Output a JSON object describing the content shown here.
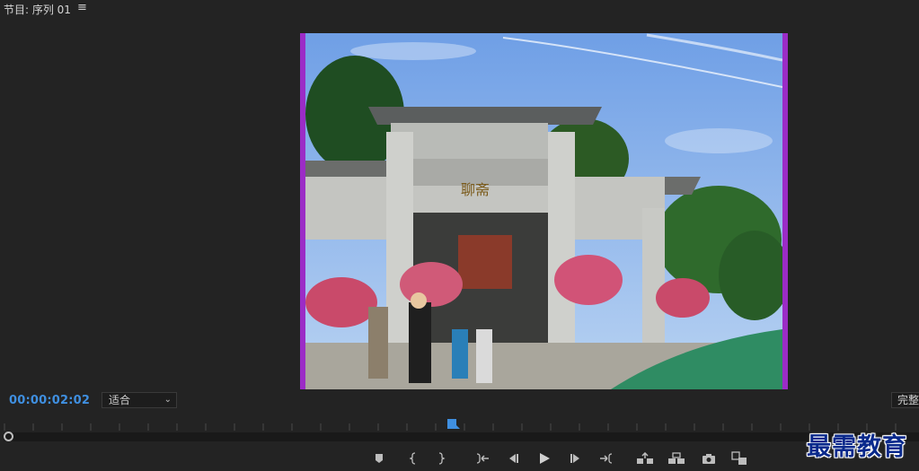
{
  "panel": {
    "title": "节目: 序列 01",
    "menu_icon": "hamburger-menu-icon"
  },
  "monitor": {
    "image_description": "stone memorial archway",
    "archway_inscription": "聊斋",
    "border_color": "#9b2cc6"
  },
  "status": {
    "timecode": "00:00:02:02",
    "zoom_value": "适合",
    "resolution_value": "完整"
  },
  "controls": [
    {
      "name": "add-marker-button",
      "icon": "marker-icon"
    },
    {
      "name": "mark-in-button",
      "icon": "mark-in-icon"
    },
    {
      "name": "mark-out-button",
      "icon": "mark-out-icon"
    },
    {
      "name": "go-to-in-button",
      "icon": "go-to-in-icon"
    },
    {
      "name": "step-back-button",
      "icon": "step-back-icon"
    },
    {
      "name": "play-button",
      "icon": "play-icon"
    },
    {
      "name": "step-forward-button",
      "icon": "step-forward-icon"
    },
    {
      "name": "go-to-out-button",
      "icon": "go-to-out-icon"
    },
    {
      "name": "lift-button",
      "icon": "lift-icon"
    },
    {
      "name": "extract-button",
      "icon": "extract-icon"
    },
    {
      "name": "export-frame-button",
      "icon": "camera-icon"
    },
    {
      "name": "comparison-view-button",
      "icon": "comparison-icon"
    }
  ],
  "watermark": "最需教育",
  "colors": {
    "accent": "#3f8fe0",
    "background": "#232323"
  }
}
